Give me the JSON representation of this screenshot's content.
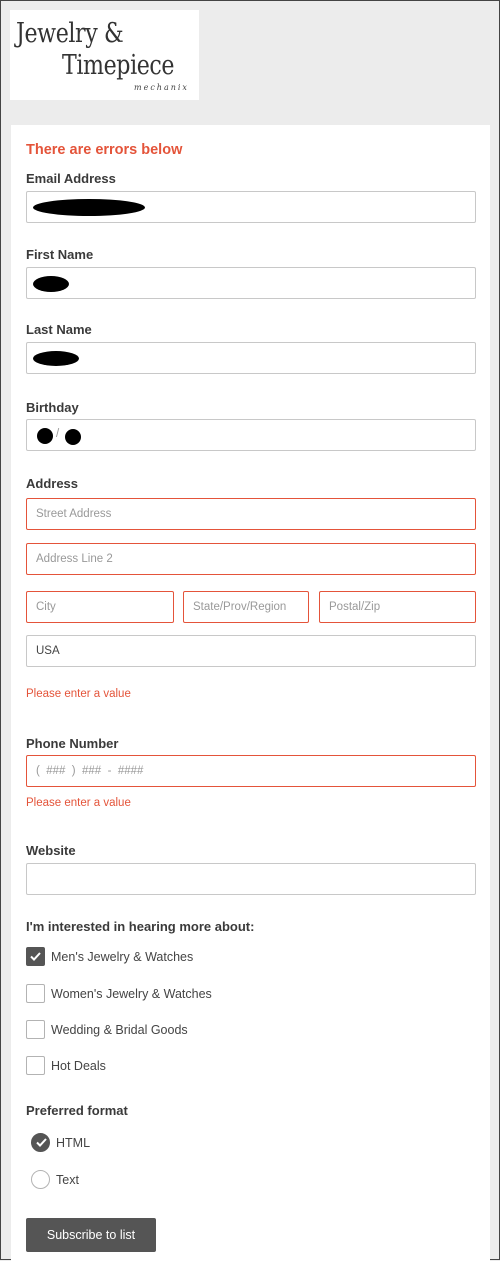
{
  "logo": {
    "line1": "Jewelry &",
    "line2": "Timepiece",
    "sub": "mechanix"
  },
  "form": {
    "error_heading": "There are errors below",
    "email_label": "Email Address",
    "first_name_label": "First Name",
    "last_name_label": "Last Name",
    "birthday_label": "Birthday",
    "birthday_separator": "/",
    "address_label": "Address",
    "street_placeholder": "Street Address",
    "address2_placeholder": "Address Line 2",
    "city_placeholder": "City",
    "state_placeholder": "State/Prov/Region",
    "zip_placeholder": "Postal/Zip",
    "country_value": "USA",
    "address_error": "Please enter a value",
    "phone_label": "Phone Number",
    "phone_placeholder": "(  ###  )  ###  -  ####",
    "phone_error": "Please enter a value",
    "website_label": "Website",
    "interests_label": "I'm interested in hearing more about:",
    "interests": [
      {
        "label": "Men's Jewelry & Watches",
        "checked": true
      },
      {
        "label": "Women's Jewelry & Watches",
        "checked": false
      },
      {
        "label": "Wedding & Bridal Goods",
        "checked": false
      },
      {
        "label": "Hot Deals",
        "checked": false
      }
    ],
    "format_label": "Preferred format",
    "formats": [
      {
        "label": "HTML",
        "selected": true
      },
      {
        "label": "Text",
        "selected": false
      }
    ],
    "submit_label": "Subscribe to list"
  },
  "colors": {
    "error": "#e4543a",
    "button": "#555555",
    "page_bg": "#ececec"
  },
  "icons": {
    "check": "check-icon"
  }
}
